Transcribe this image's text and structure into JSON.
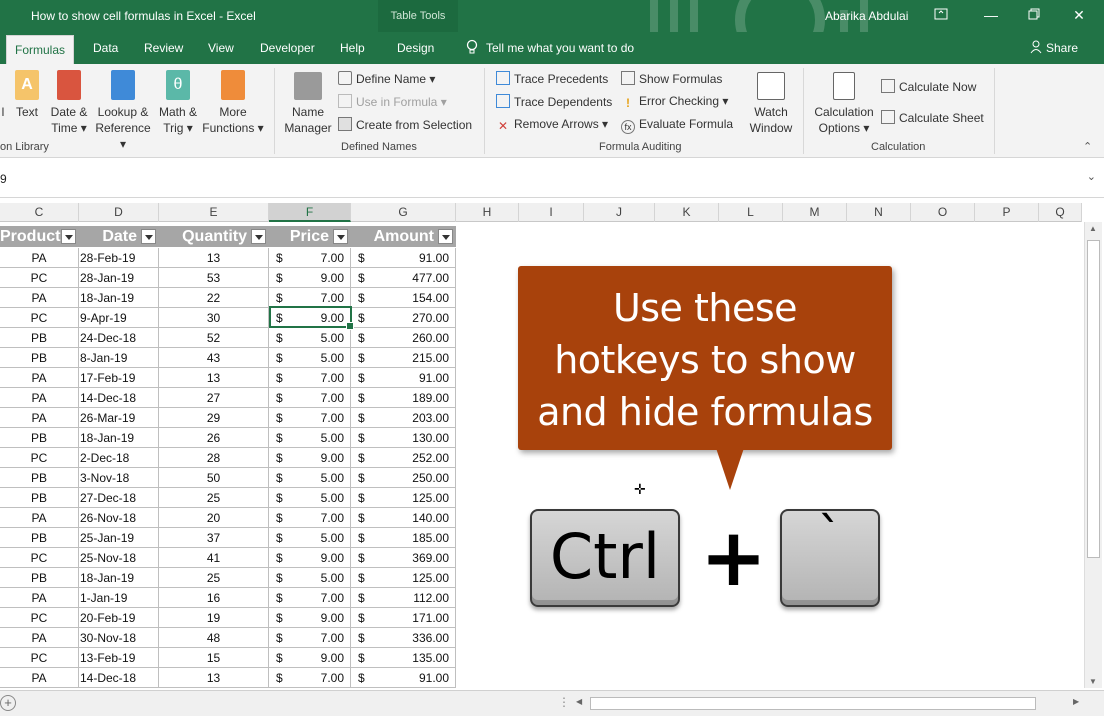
{
  "titlebar": {
    "title": "How to show cell formulas in Excel  -  Excel",
    "table_tools": "Table Tools",
    "user": "Abarika Abdulai"
  },
  "tabs": [
    "Formulas",
    "Data",
    "Review",
    "View",
    "Developer",
    "Help",
    "Design"
  ],
  "tell_me": "Tell me what you want to do",
  "share": "Share",
  "ribbon": {
    "function_library": {
      "label": "on Library",
      "buttons": [
        {
          "line1": "l",
          "line2": ""
        },
        {
          "line1": "Text",
          "line2": "▾"
        },
        {
          "line1": "Date &",
          "line2": "Time ▾"
        },
        {
          "line1": "Lookup &",
          "line2": "Reference ▾"
        },
        {
          "line1": "Math &",
          "line2": "Trig ▾"
        },
        {
          "line1": "More",
          "line2": "Functions ▾"
        }
      ]
    },
    "defined_names": {
      "label": "Defined Names",
      "name_manager": [
        "Name",
        "Manager"
      ],
      "define_name": "Define Name ▾",
      "use_in_formula": "Use in Formula ▾",
      "create_from_selection": "Create from Selection"
    },
    "formula_auditing": {
      "label": "Formula Auditing",
      "trace_precedents": "Trace Precedents",
      "trace_dependents": "Trace Dependents",
      "remove_arrows": "Remove Arrows ▾",
      "show_formulas": "Show Formulas",
      "error_checking": "Error Checking ▾",
      "evaluate_formula": "Evaluate Formula",
      "watch_window": [
        "Watch",
        "Window"
      ]
    },
    "calculation": {
      "label": "Calculation",
      "calculation_options": [
        "Calculation",
        "Options ▾"
      ],
      "calculate_now": "Calculate Now",
      "calculate_sheet": "Calculate Sheet"
    }
  },
  "formula_bar": {
    "name_box": "9"
  },
  "columns": [
    "C",
    "D",
    "E",
    "F",
    "G",
    "H",
    "I",
    "J",
    "K",
    "L",
    "M",
    "N",
    "O",
    "P",
    "Q"
  ],
  "selected_column": "F",
  "table": {
    "headers": [
      "Product",
      "Date",
      "Quantity",
      "Price",
      "Amount"
    ],
    "currency_symbol": "$",
    "rows": [
      [
        "PA",
        "28-Feb-19",
        "13",
        "7.00",
        "91.00"
      ],
      [
        "PC",
        "28-Jan-19",
        "53",
        "9.00",
        "477.00"
      ],
      [
        "PA",
        "18-Jan-19",
        "22",
        "7.00",
        "154.00"
      ],
      [
        "PC",
        "9-Apr-19",
        "30",
        "9.00",
        "270.00"
      ],
      [
        "PB",
        "24-Dec-18",
        "52",
        "5.00",
        "260.00"
      ],
      [
        "PB",
        "8-Jan-19",
        "43",
        "5.00",
        "215.00"
      ],
      [
        "PA",
        "17-Feb-19",
        "13",
        "7.00",
        "91.00"
      ],
      [
        "PA",
        "14-Dec-18",
        "27",
        "7.00",
        "189.00"
      ],
      [
        "PA",
        "26-Mar-19",
        "29",
        "7.00",
        "203.00"
      ],
      [
        "PB",
        "18-Jan-19",
        "26",
        "5.00",
        "130.00"
      ],
      [
        "PC",
        "2-Dec-18",
        "28",
        "9.00",
        "252.00"
      ],
      [
        "PB",
        "3-Nov-18",
        "50",
        "5.00",
        "250.00"
      ],
      [
        "PB",
        "27-Dec-18",
        "25",
        "5.00",
        "125.00"
      ],
      [
        "PA",
        "26-Nov-18",
        "20",
        "7.00",
        "140.00"
      ],
      [
        "PB",
        "25-Jan-19",
        "37",
        "5.00",
        "185.00"
      ],
      [
        "PC",
        "25-Nov-18",
        "41",
        "9.00",
        "369.00"
      ],
      [
        "PB",
        "18-Jan-19",
        "25",
        "5.00",
        "125.00"
      ],
      [
        "PA",
        "1-Jan-19",
        "16",
        "7.00",
        "112.00"
      ],
      [
        "PC",
        "20-Feb-19",
        "19",
        "9.00",
        "171.00"
      ],
      [
        "PA",
        "30-Nov-18",
        "48",
        "7.00",
        "336.00"
      ],
      [
        "PC",
        "13-Feb-19",
        "15",
        "9.00",
        "135.00"
      ],
      [
        "PA",
        "14-Dec-18",
        "13",
        "7.00",
        "91.00"
      ]
    ]
  },
  "callout": {
    "lines": [
      "Use these",
      "hotkeys to show",
      "and hide formulas"
    ],
    "color": "#a8420c"
  },
  "hotkey": {
    "key1": "Ctrl",
    "plus": "+",
    "key2": "`"
  },
  "colors": {
    "excel_green": "#217346",
    "header_gray": "#a6a6a6"
  }
}
